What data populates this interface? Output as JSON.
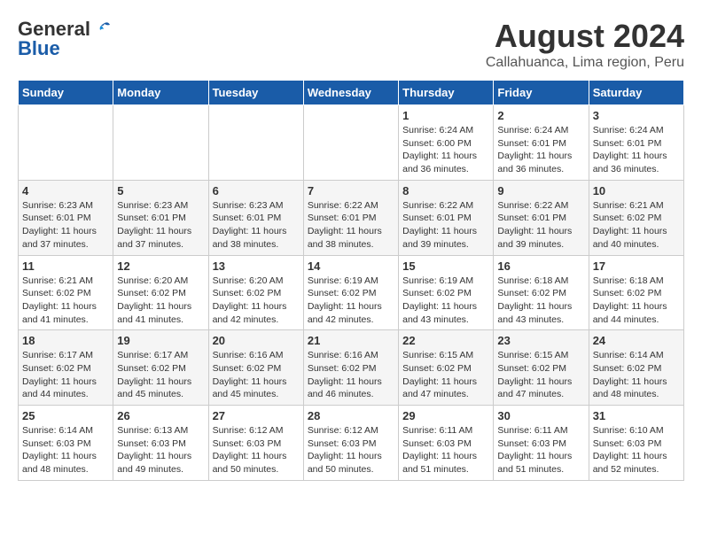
{
  "logo": {
    "general": "General",
    "blue": "Blue"
  },
  "title": {
    "month": "August 2024",
    "location": "Callahuanca, Lima region, Peru"
  },
  "headers": [
    "Sunday",
    "Monday",
    "Tuesday",
    "Wednesday",
    "Thursday",
    "Friday",
    "Saturday"
  ],
  "weeks": [
    [
      {
        "day": "",
        "text": ""
      },
      {
        "day": "",
        "text": ""
      },
      {
        "day": "",
        "text": ""
      },
      {
        "day": "",
        "text": ""
      },
      {
        "day": "1",
        "text": "Sunrise: 6:24 AM\nSunset: 6:00 PM\nDaylight: 11 hours and 36 minutes."
      },
      {
        "day": "2",
        "text": "Sunrise: 6:24 AM\nSunset: 6:01 PM\nDaylight: 11 hours and 36 minutes."
      },
      {
        "day": "3",
        "text": "Sunrise: 6:24 AM\nSunset: 6:01 PM\nDaylight: 11 hours and 36 minutes."
      }
    ],
    [
      {
        "day": "4",
        "text": "Sunrise: 6:23 AM\nSunset: 6:01 PM\nDaylight: 11 hours and 37 minutes."
      },
      {
        "day": "5",
        "text": "Sunrise: 6:23 AM\nSunset: 6:01 PM\nDaylight: 11 hours and 37 minutes."
      },
      {
        "day": "6",
        "text": "Sunrise: 6:23 AM\nSunset: 6:01 PM\nDaylight: 11 hours and 38 minutes."
      },
      {
        "day": "7",
        "text": "Sunrise: 6:22 AM\nSunset: 6:01 PM\nDaylight: 11 hours and 38 minutes."
      },
      {
        "day": "8",
        "text": "Sunrise: 6:22 AM\nSunset: 6:01 PM\nDaylight: 11 hours and 39 minutes."
      },
      {
        "day": "9",
        "text": "Sunrise: 6:22 AM\nSunset: 6:01 PM\nDaylight: 11 hours and 39 minutes."
      },
      {
        "day": "10",
        "text": "Sunrise: 6:21 AM\nSunset: 6:02 PM\nDaylight: 11 hours and 40 minutes."
      }
    ],
    [
      {
        "day": "11",
        "text": "Sunrise: 6:21 AM\nSunset: 6:02 PM\nDaylight: 11 hours and 41 minutes."
      },
      {
        "day": "12",
        "text": "Sunrise: 6:20 AM\nSunset: 6:02 PM\nDaylight: 11 hours and 41 minutes."
      },
      {
        "day": "13",
        "text": "Sunrise: 6:20 AM\nSunset: 6:02 PM\nDaylight: 11 hours and 42 minutes."
      },
      {
        "day": "14",
        "text": "Sunrise: 6:19 AM\nSunset: 6:02 PM\nDaylight: 11 hours and 42 minutes."
      },
      {
        "day": "15",
        "text": "Sunrise: 6:19 AM\nSunset: 6:02 PM\nDaylight: 11 hours and 43 minutes."
      },
      {
        "day": "16",
        "text": "Sunrise: 6:18 AM\nSunset: 6:02 PM\nDaylight: 11 hours and 43 minutes."
      },
      {
        "day": "17",
        "text": "Sunrise: 6:18 AM\nSunset: 6:02 PM\nDaylight: 11 hours and 44 minutes."
      }
    ],
    [
      {
        "day": "18",
        "text": "Sunrise: 6:17 AM\nSunset: 6:02 PM\nDaylight: 11 hours and 44 minutes."
      },
      {
        "day": "19",
        "text": "Sunrise: 6:17 AM\nSunset: 6:02 PM\nDaylight: 11 hours and 45 minutes."
      },
      {
        "day": "20",
        "text": "Sunrise: 6:16 AM\nSunset: 6:02 PM\nDaylight: 11 hours and 45 minutes."
      },
      {
        "day": "21",
        "text": "Sunrise: 6:16 AM\nSunset: 6:02 PM\nDaylight: 11 hours and 46 minutes."
      },
      {
        "day": "22",
        "text": "Sunrise: 6:15 AM\nSunset: 6:02 PM\nDaylight: 11 hours and 47 minutes."
      },
      {
        "day": "23",
        "text": "Sunrise: 6:15 AM\nSunset: 6:02 PM\nDaylight: 11 hours and 47 minutes."
      },
      {
        "day": "24",
        "text": "Sunrise: 6:14 AM\nSunset: 6:02 PM\nDaylight: 11 hours and 48 minutes."
      }
    ],
    [
      {
        "day": "25",
        "text": "Sunrise: 6:14 AM\nSunset: 6:03 PM\nDaylight: 11 hours and 48 minutes."
      },
      {
        "day": "26",
        "text": "Sunrise: 6:13 AM\nSunset: 6:03 PM\nDaylight: 11 hours and 49 minutes."
      },
      {
        "day": "27",
        "text": "Sunrise: 6:12 AM\nSunset: 6:03 PM\nDaylight: 11 hours and 50 minutes."
      },
      {
        "day": "28",
        "text": "Sunrise: 6:12 AM\nSunset: 6:03 PM\nDaylight: 11 hours and 50 minutes."
      },
      {
        "day": "29",
        "text": "Sunrise: 6:11 AM\nSunset: 6:03 PM\nDaylight: 11 hours and 51 minutes."
      },
      {
        "day": "30",
        "text": "Sunrise: 6:11 AM\nSunset: 6:03 PM\nDaylight: 11 hours and 51 minutes."
      },
      {
        "day": "31",
        "text": "Sunrise: 6:10 AM\nSunset: 6:03 PM\nDaylight: 11 hours and 52 minutes."
      }
    ]
  ]
}
